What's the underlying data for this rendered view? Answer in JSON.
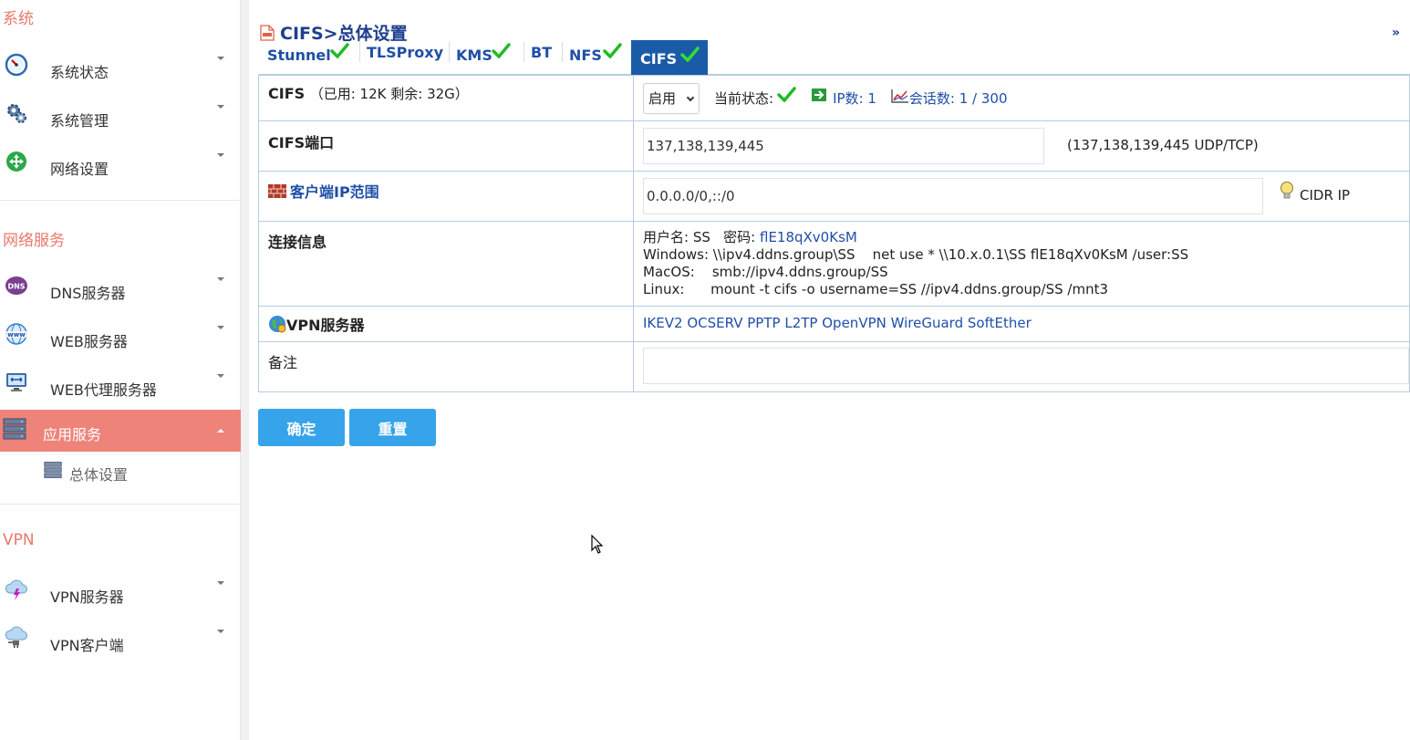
{
  "sidebar": {
    "sections": [
      {
        "title": "系统",
        "items": [
          {
            "label": "系统状态",
            "icon": "gauge-icon"
          },
          {
            "label": "系统管理",
            "icon": "gears-icon"
          },
          {
            "label": "网络设置",
            "icon": "network-icon"
          }
        ]
      },
      {
        "title": "网络服务",
        "items": [
          {
            "label": "DNS服务器",
            "icon": "dns-icon"
          },
          {
            "label": "WEB服务器",
            "icon": "www-icon"
          },
          {
            "label": "WEB代理服务器",
            "icon": "proxy-monitor-icon"
          },
          {
            "label": "应用服务",
            "icon": "server-rack-icon",
            "active": true
          }
        ],
        "subitems": [
          {
            "label": "总体设置",
            "icon": "server-rack-icon"
          }
        ]
      },
      {
        "title": "VPN",
        "items": [
          {
            "label": "VPN服务器",
            "icon": "cloud-bolt-icon"
          },
          {
            "label": "VPN客户端",
            "icon": "cloud-plug-icon"
          }
        ]
      }
    ]
  },
  "header": {
    "title": "CIFS>总体设置",
    "collapse": "»"
  },
  "tabs": [
    {
      "label": "Stunnel",
      "ok": true
    },
    {
      "label": "TLSProxy",
      "ok": false
    },
    {
      "label": "KMS",
      "ok": true
    },
    {
      "label": "BT",
      "ok": false
    },
    {
      "label": "NFS",
      "ok": true
    },
    {
      "label": "CIFS",
      "ok": true,
      "active": true
    }
  ],
  "form": {
    "cifs": {
      "label": "CIFS",
      "usage": "（已用: 12K   剩余: 32G）",
      "select_value": "启用",
      "status_label": "当前状态:",
      "ip_count": "IP数: 1",
      "sessions": "会话数: 1 / 300"
    },
    "port": {
      "label": "CIFS端口",
      "value": "137,138,139,445",
      "hint": "(137,138,139,445 UDP/TCP)"
    },
    "client_ip": {
      "label": "客户端IP范围",
      "value": "0.0.0.0/0,::/0",
      "hint": "CIDR IP"
    },
    "conn_info": {
      "label": "连接信息",
      "user_line_prefix": "用户名: SS   密码: ",
      "password": "flE18qXv0KsM",
      "windows": "Windows: \\\\ipv4.ddns.group\\SS    net use * \\\\10.x.0.1\\SS flE18qXv0KsM /user:SS",
      "macos": "MacOS:    smb://ipv4.ddns.group/SS",
      "linux": "Linux:      mount -t cifs -o username=SS //ipv4.ddns.group/SS /mnt3"
    },
    "vpn": {
      "label": "VPN服务器",
      "links": [
        "IKEV2",
        "OCSERV",
        "PPTP",
        "L2TP",
        "OpenVPN",
        "WireGuard",
        "SoftEther"
      ]
    },
    "remark": {
      "label": "备注",
      "value": ""
    }
  },
  "buttons": {
    "confirm": "确定",
    "reset": "重置"
  },
  "colors": {
    "accent": "#ee837a",
    "tab_active": "#1a5ba8",
    "button": "#36a3eb",
    "link": "#1f4fa6",
    "ok": "#22bb22"
  }
}
